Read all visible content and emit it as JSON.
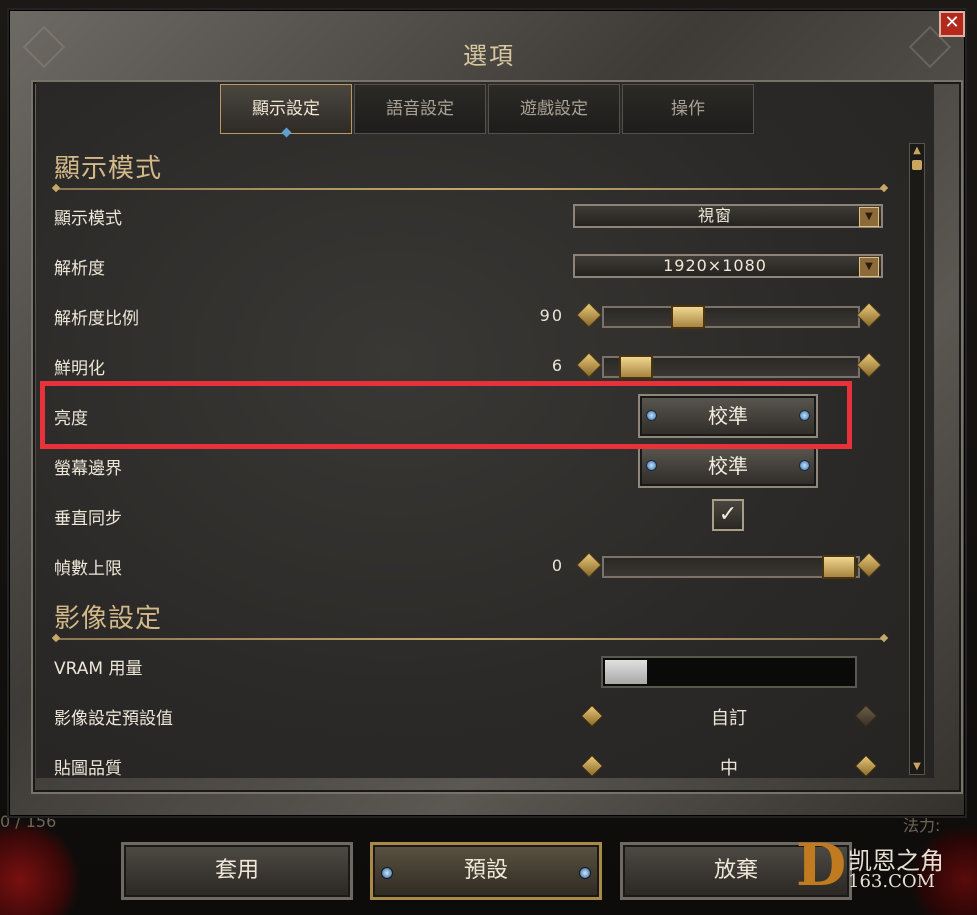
{
  "window": {
    "title": "選項",
    "close_glyph": "✕"
  },
  "tabs": [
    {
      "label": "顯示設定",
      "active": true
    },
    {
      "label": "語音設定",
      "active": false
    },
    {
      "label": "遊戲設定",
      "active": false
    },
    {
      "label": "操作",
      "active": false
    }
  ],
  "display_section": {
    "heading": "顯示模式",
    "display_mode": {
      "label": "顯示模式",
      "value": "視窗"
    },
    "resolution": {
      "label": "解析度",
      "value": "1920×1080"
    },
    "resolution_scale": {
      "label": "解析度比例",
      "value": "90",
      "fraction": 0.3
    },
    "sharpening": {
      "label": "鮮明化",
      "value": "6",
      "fraction": 0.06
    },
    "brightness": {
      "label": "亮度",
      "button": "校準"
    },
    "screen_bounds": {
      "label": "螢幕邊界",
      "button": "校準"
    },
    "vsync": {
      "label": "垂直同步",
      "checked": true,
      "check_glyph": "✓"
    },
    "frame_cap": {
      "label": "幀數上限",
      "value": "0",
      "fraction": 1.0
    }
  },
  "video_section": {
    "heading": "影像設定",
    "vram": {
      "label": "VRAM 用量",
      "fraction": 0.17
    },
    "preset": {
      "label": "影像設定預設值",
      "value": "自訂"
    },
    "texture_quality": {
      "label": "貼圖品質",
      "value": "中"
    }
  },
  "footer": {
    "apply": "套用",
    "defaults": "預設",
    "discard": "放棄"
  },
  "background": {
    "left_text": "0 / 156",
    "right_text": "法力:"
  },
  "logo": {
    "letter": "D",
    "name": "凯恩之角",
    "domain": "163.COM"
  },
  "colors": {
    "accent_gold": "#c9a55e",
    "highlight": "#e8323a",
    "gem_blue": "#5fa0d0"
  }
}
